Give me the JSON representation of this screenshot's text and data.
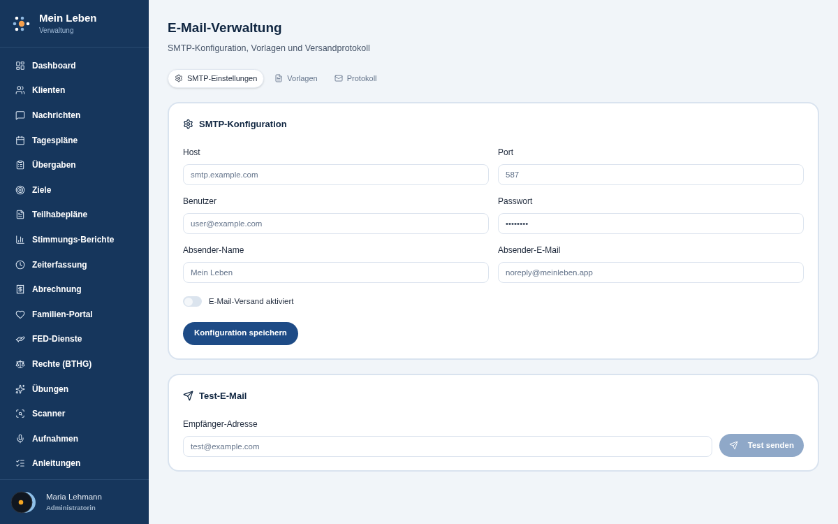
{
  "brand": {
    "title": "Mein Leben",
    "subtitle": "Verwaltung"
  },
  "sidebar": {
    "items": [
      {
        "label": "Dashboard",
        "selected": false
      },
      {
        "label": "Klienten",
        "selected": false
      },
      {
        "label": "Nachrichten",
        "selected": false
      },
      {
        "label": "Tagespläne",
        "selected": false
      },
      {
        "label": "Übergaben",
        "selected": false
      },
      {
        "label": "Ziele",
        "selected": false
      },
      {
        "label": "Teilhabepläne",
        "selected": false
      },
      {
        "label": "Stimmungs-Berichte",
        "selected": false
      },
      {
        "label": "Zeiterfassung",
        "selected": false
      },
      {
        "label": "Abrechnung",
        "selected": false
      },
      {
        "label": "Familien-Portal",
        "selected": false
      },
      {
        "label": "FED-Dienste",
        "selected": false
      },
      {
        "label": "Rechte (BTHG)",
        "selected": false
      },
      {
        "label": "Übungen",
        "selected": false
      },
      {
        "label": "Scanner",
        "selected": false
      },
      {
        "label": "Aufnahmen",
        "selected": false
      },
      {
        "label": "Anleitungen",
        "selected": false
      }
    ]
  },
  "user": {
    "name": "Maria Lehmann",
    "role": "Administratorin"
  },
  "page": {
    "title": "E-Mail-Verwaltung",
    "subtitle": "SMTP-Konfiguration, Vorlagen und Versandprotokoll"
  },
  "tabs": [
    {
      "label": "SMTP-Einstellungen",
      "selected": true
    },
    {
      "label": "Vorlagen",
      "selected": false
    },
    {
      "label": "Protokoll",
      "selected": false
    }
  ],
  "smtp_card": {
    "title": "SMTP-Konfiguration",
    "fields": [
      {
        "label": "Host",
        "placeholder": "smtp.example.com"
      },
      {
        "label": "Port",
        "placeholder": "587"
      },
      {
        "label": "Benutzer",
        "placeholder": "user@example.com"
      },
      {
        "label": "Passwort",
        "value": "••••••••"
      },
      {
        "label": "Absender-Name",
        "placeholder": "Mein Leben"
      },
      {
        "label": "Absender-E-Mail",
        "placeholder": "noreply@meinleben.app"
      }
    ],
    "toggle": {
      "label": "E-Mail-Versand aktiviert",
      "on": false
    },
    "save_button": "Konfiguration speichern"
  },
  "test_card": {
    "title": "Test-E-Mail",
    "field": {
      "label": "Empfänger-Adresse",
      "placeholder": "test@example.com"
    },
    "send_button": {
      "label": "Test senden",
      "disabled": true
    }
  }
}
